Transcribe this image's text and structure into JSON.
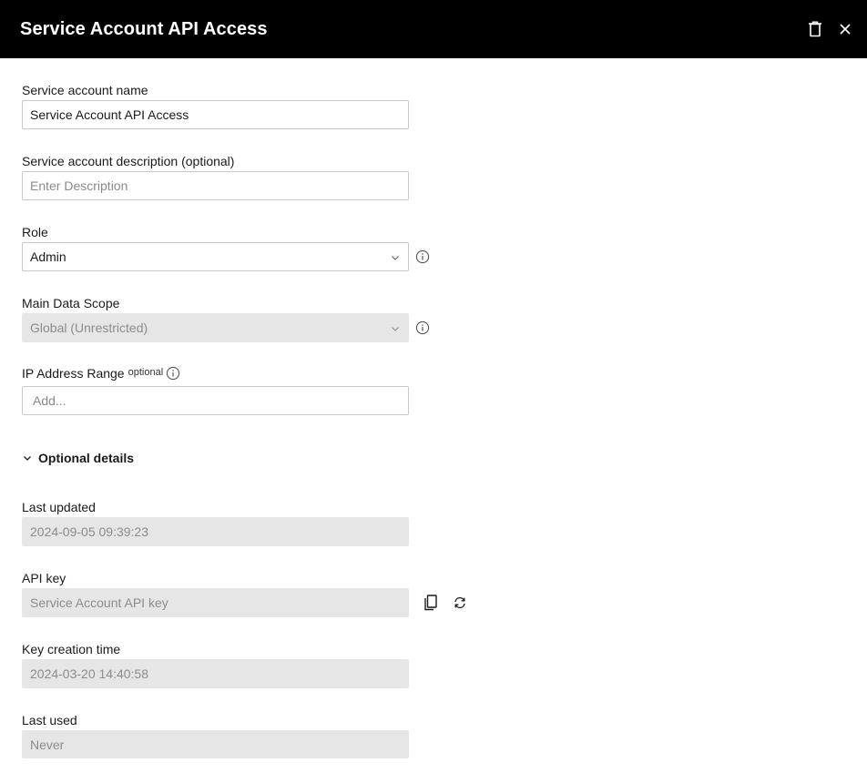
{
  "header": {
    "title": "Service Account API Access",
    "delete_icon": "trash-icon",
    "close_icon": "close-icon"
  },
  "form": {
    "name": {
      "label": "Service account name",
      "value": "Service Account API Access"
    },
    "description": {
      "label": "Service account description (optional)",
      "placeholder": "Enter Description"
    },
    "role": {
      "label": "Role",
      "value": "Admin"
    },
    "scope": {
      "label": "Main Data Scope",
      "value": "Global (Unrestricted)"
    },
    "ip_range": {
      "label": "IP Address Range",
      "optional_tag": "optional",
      "placeholder": "Add..."
    }
  },
  "optional_details": {
    "toggle_label": "Optional details",
    "last_updated": {
      "label": "Last updated",
      "value": "2024-09-05 09:39:23"
    },
    "api_key": {
      "label": "API key",
      "placeholder": "Service Account API key",
      "copy_icon": "copy-icon",
      "regenerate_icon": "refresh-icon"
    },
    "key_creation_time": {
      "label": "Key creation time",
      "value": "2024-03-20 14:40:58"
    },
    "last_used": {
      "label": "Last used",
      "value": "Never"
    }
  },
  "colors": {
    "header_bg": "#000000",
    "disabled_bg": "#e6e6e6",
    "border": "#c8c8c8"
  }
}
